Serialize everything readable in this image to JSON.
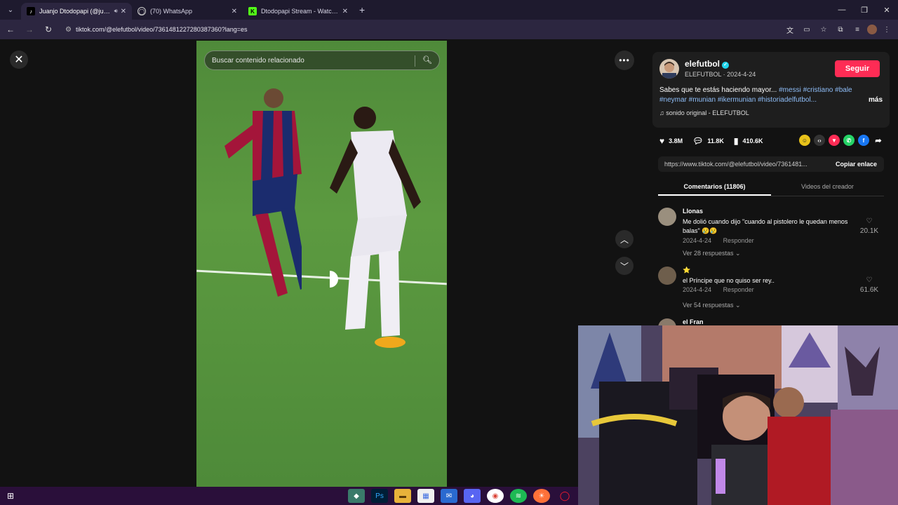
{
  "browser": {
    "tabs": [
      {
        "title": "Juanjo Dtodopapi (@juanjo",
        "favicon": "tiktok-icon",
        "active": true
      },
      {
        "title": "(70) WhatsApp",
        "favicon": "whatsapp-icon",
        "active": false
      },
      {
        "title": "Dtodopapi Stream - Watch Live",
        "favicon": "kick-icon",
        "active": false
      }
    ],
    "url": "tiktok.com/@elefutbol/video/7361481227280387360?lang=es"
  },
  "video": {
    "search_placeholder": "Buscar contenido relacionado"
  },
  "author": {
    "name": "elefutbol",
    "sub": "ELEFUTBOL · 2024-4-24",
    "follow_label": "Seguir"
  },
  "description": {
    "text": "Sabes que te estás haciendo mayor... ",
    "tags_line1": "#messi #cristiano #bale",
    "tags_line2": "#neymar #munian #ikermunian #historiadelfutbol...",
    "more": "más",
    "sound": "♫  sonido original - ELEFUTBOL"
  },
  "stats": {
    "likes": "3.8M",
    "comments": "11.8K",
    "saves": "410.6K"
  },
  "link": {
    "url": "https://www.tiktok.com/@elefutbol/video/7361481...",
    "copy_label": "Copiar enlace"
  },
  "panel_tabs": {
    "comments": "Comentarios (11806)",
    "creator_videos": "Videos del creador"
  },
  "comments": [
    {
      "user": "Llonas",
      "text": "Me dolió cuando dijo \"cuando al pistolero le quedan menos balas\" 😢😢",
      "date": "2024-4-24",
      "reply_label": "Responder",
      "replies": "Ver 28 respuestas ⌄",
      "likes": "20.1K"
    },
    {
      "user": "⭐",
      "text": "el Príncipe que no quiso ser rey..",
      "date": "2024-4-24",
      "reply_label": "Responder",
      "replies": "Ver 54 respuestas ⌄",
      "likes": "61.6K"
    },
    {
      "user": "el Fran",
      "text": "",
      "date": "",
      "reply_label": "",
      "replies": "",
      "likes": ""
    }
  ],
  "colors": {
    "accent": "#fe2c55",
    "hashtag": "#8fbef8",
    "taskbar": "#2a0f3a"
  }
}
